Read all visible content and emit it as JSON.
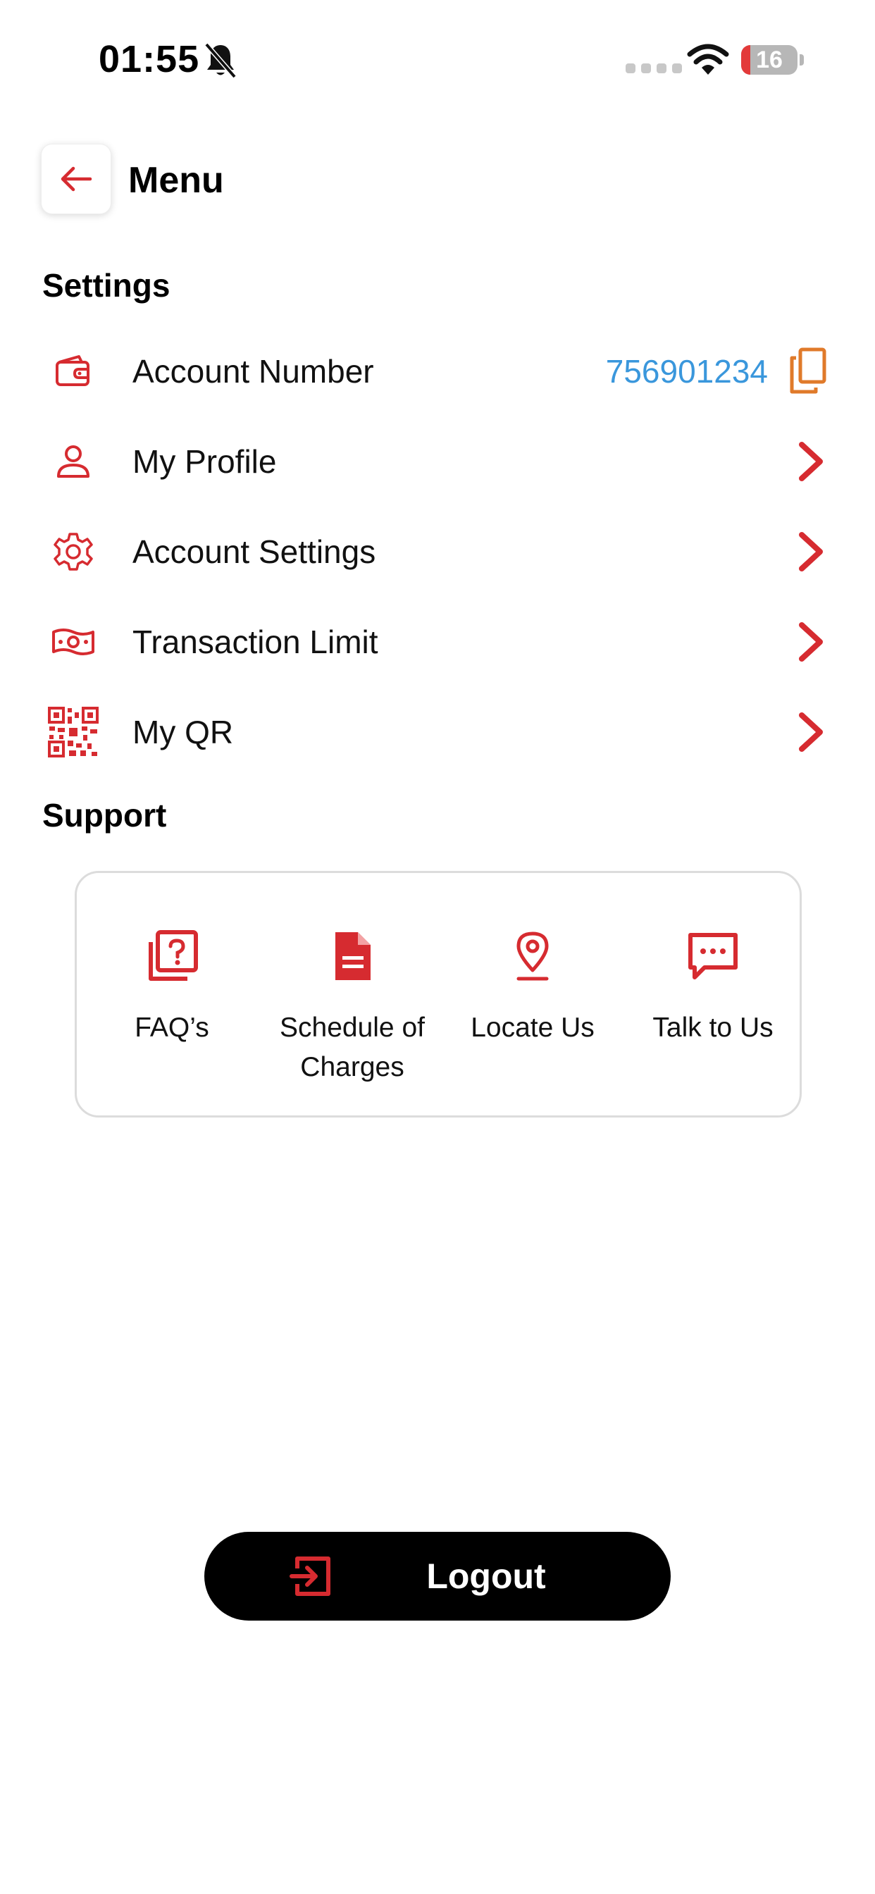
{
  "status_bar": {
    "time": "01:55",
    "battery": "16",
    "battery_level": 0.16
  },
  "header": {
    "title": "Menu"
  },
  "settings": {
    "title": "Settings",
    "items": [
      {
        "label": "Account Number",
        "value": "756901234",
        "icon": "wallet-icon"
      },
      {
        "label": "My Profile",
        "icon": "user-icon"
      },
      {
        "label": "Account Settings",
        "icon": "gear-icon"
      },
      {
        "label": "Transaction Limit",
        "icon": "banknote-icon"
      },
      {
        "label": "My QR",
        "icon": "qr-code-icon"
      }
    ]
  },
  "support": {
    "title": "Support",
    "items": [
      {
        "label": "FAQ’s",
        "icon": "faq-icon"
      },
      {
        "label": "Schedule of Charges",
        "icon": "document-icon"
      },
      {
        "label": "Locate Us",
        "icon": "location-pin-icon"
      },
      {
        "label": "Talk to Us",
        "icon": "chat-icon"
      }
    ]
  },
  "logout": {
    "label": "Logout",
    "icon": "logout-icon"
  },
  "colors": {
    "accent": "#d62b30",
    "link": "#3a97dc",
    "copy": "#e07a2a",
    "button": "#000000"
  }
}
